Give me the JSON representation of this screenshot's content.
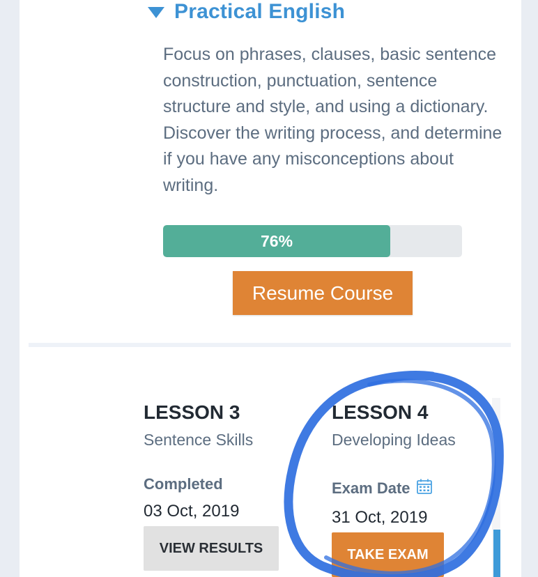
{
  "course": {
    "title": "Practical English",
    "description": "Focus on phrases, clauses, basic sentence construction, punctuation, sentence structure and style, and using a dictionary. Discover the writing process, and determine if you have any misconceptions about writing.",
    "progress_percent": 76,
    "progress_label": "76%",
    "resume_label": "Resume Course"
  },
  "lessons": [
    {
      "title": "LESSON 3",
      "subtitle": "Sentence Skills",
      "meta_label": "Completed",
      "meta_value": "03 Oct, 2019",
      "action_label": "VIEW RESULTS"
    },
    {
      "title": "LESSON 4",
      "subtitle": "Developing Ideas",
      "meta_label": "Exam Date",
      "meta_value": "31 Oct, 2019",
      "action_label": "TAKE EXAM"
    }
  ],
  "colors": {
    "accent_blue": "#3d92d4",
    "progress_green": "#53ae98",
    "action_orange": "#df8435",
    "annotation_blue": "#2f6fe0"
  },
  "icons": {
    "course_toggle": "caret-down-icon",
    "exam_date": "calendar-icon"
  }
}
